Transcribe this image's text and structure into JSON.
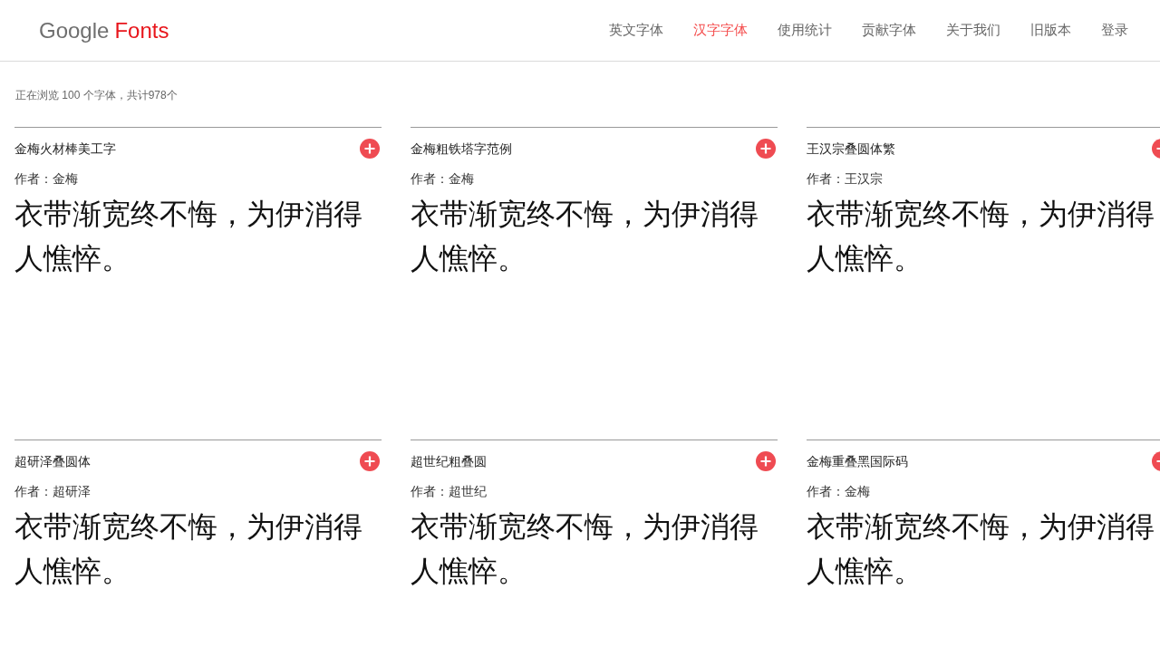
{
  "header": {
    "logo": {
      "brand": "Google",
      "product": "Fonts"
    },
    "nav": [
      {
        "label": "英文字体",
        "selected": false
      },
      {
        "label": "汉字字体",
        "selected": true
      },
      {
        "label": "使用统计",
        "selected": false
      },
      {
        "label": "贡献字体",
        "selected": false
      },
      {
        "label": "关于我们",
        "selected": false
      },
      {
        "label": "旧版本",
        "selected": false
      },
      {
        "label": "登录",
        "selected": false
      }
    ]
  },
  "summary": "正在浏览 100 个字体，共计978个",
  "fonts": [
    {
      "name": "金梅火材棒美工字",
      "author": "作者：金梅",
      "sample": "衣带渐宽终不悔，为伊消得人憔悴。"
    },
    {
      "name": "金梅粗铁塔字范例",
      "author": "作者：金梅",
      "sample": "衣带渐宽终不悔，为伊消得人憔悴。"
    },
    {
      "name": "王汉宗叠圆体繁",
      "author": "作者：王汉宗",
      "sample": "衣带渐宽终不悔，为伊消得人憔悴。"
    },
    {
      "name": "超研泽叠圆体",
      "author": "作者：超研泽",
      "sample": "衣带渐宽终不悔，为伊消得人憔悴。"
    },
    {
      "name": "超世纪粗叠圆",
      "author": "作者：超世纪",
      "sample": "衣带渐宽终不悔，为伊消得人憔悴。"
    },
    {
      "name": "金梅重叠黑国际码",
      "author": "作者：金梅",
      "sample": "衣带渐宽终不悔，为伊消得人憔悴。"
    }
  ]
}
